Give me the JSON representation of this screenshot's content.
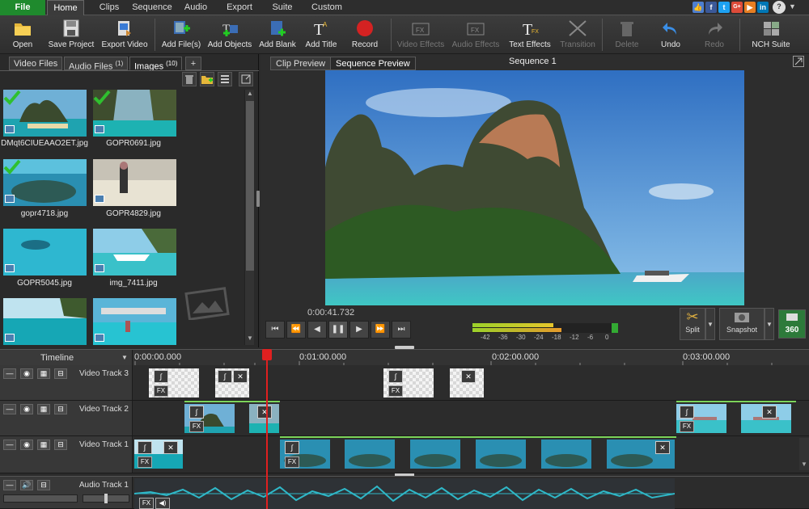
{
  "menu": {
    "tabs": [
      "File",
      "Home",
      "Clips",
      "Sequence",
      "Audio",
      "Export",
      "Suite",
      "Custom"
    ],
    "active": "Home"
  },
  "social": [
    "f",
    "t",
    "G+",
    "▶",
    "in"
  ],
  "toolbar": {
    "open": "Open",
    "save_project": "Save Project",
    "export_video": "Export Video",
    "add_files": "Add File(s)",
    "add_objects": "Add Objects",
    "add_blank": "Add Blank",
    "add_title": "Add Title",
    "record": "Record",
    "video_effects": "Video Effects",
    "audio_effects": "Audio Effects",
    "text_effects": "Text Effects",
    "transition": "Transition",
    "delete": "Delete",
    "undo": "Undo",
    "redo": "Redo",
    "nch_suite": "NCH Suite"
  },
  "media_tabs": {
    "video_files": "Video Files",
    "audio_files": "Audio Files",
    "audio_count": "(1)",
    "images": "Images",
    "images_count": "(10)",
    "add": "+"
  },
  "images": [
    {
      "name": "DMqt6CIUEAAO2ET.jpg",
      "checked": true
    },
    {
      "name": "GOPR0691.jpg",
      "checked": true
    },
    {
      "name": "gopr4718.jpg",
      "checked": true
    },
    {
      "name": "GOPR4829.jpg",
      "checked": false
    },
    {
      "name": "GOPR5045.jpg",
      "checked": false
    },
    {
      "name": "img_7411.jpg",
      "checked": false
    },
    {
      "name": "",
      "checked": false
    },
    {
      "name": "",
      "checked": false
    }
  ],
  "preview": {
    "clip_tab": "Clip Preview",
    "sequence_tab": "Sequence Preview",
    "sequence_name": "Sequence 1",
    "timecode": "0:00:41.732",
    "meter_labels": [
      "-42",
      "-36",
      "-30",
      "-24",
      "-18",
      "-12",
      "-6",
      "0"
    ],
    "split": "Split",
    "snapshot": "Snapshot",
    "deg360": "360"
  },
  "timeline": {
    "label": "Timeline",
    "ticks": [
      "0:00:00.000",
      "0:01:00.000",
      "0:02:00.000",
      "0:03:00.000"
    ],
    "tracks": [
      "Video Track 3",
      "Video Track 2",
      "Video Track 1",
      "Audio Track 1"
    ],
    "fx": "FX"
  }
}
